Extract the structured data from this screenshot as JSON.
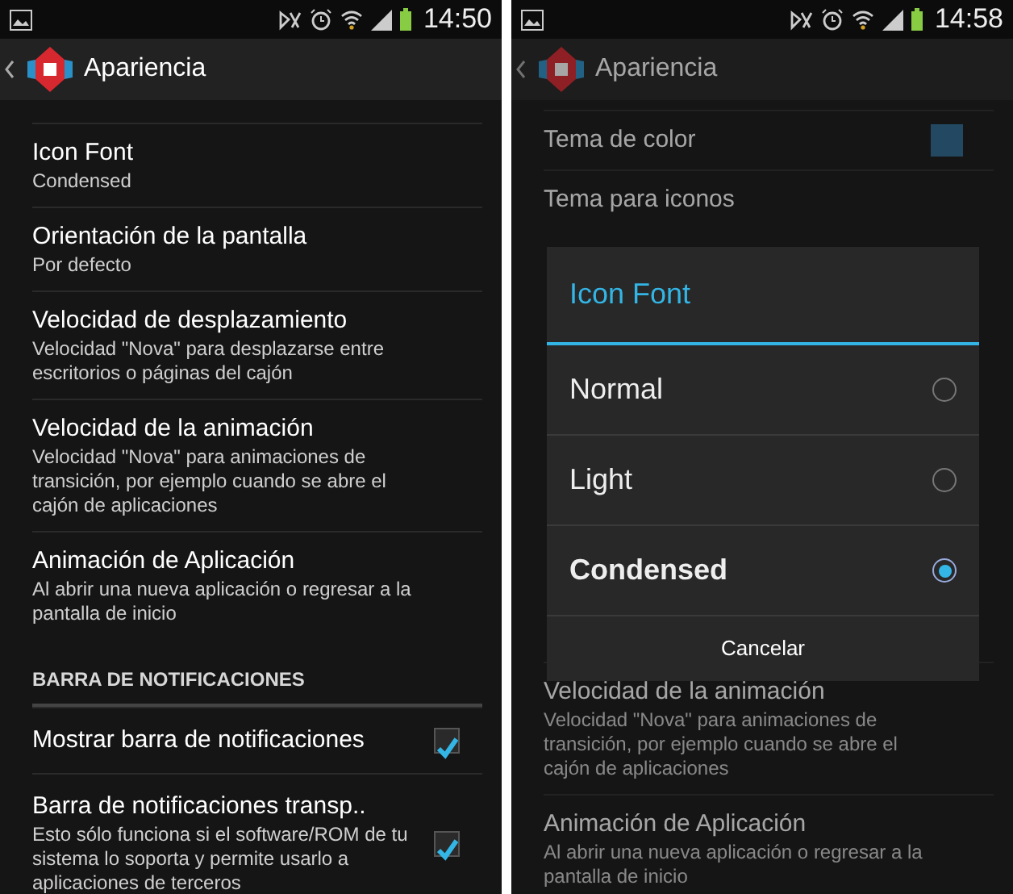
{
  "screens": [
    {
      "status_bar": {
        "time": "14:50"
      },
      "action_bar": {
        "title": "Apariencia"
      },
      "dimmed": false,
      "settings": [
        {
          "kind": "item",
          "title": "Icon Font",
          "summary": "Condensed"
        },
        {
          "kind": "item",
          "title": "Orientación de la pantalla",
          "summary": "Por defecto"
        },
        {
          "kind": "item",
          "title": "Velocidad de desplazamiento",
          "summary": "Velocidad \"Nova\" para desplazarse entre escritorios o páginas del cajón"
        },
        {
          "kind": "item",
          "title": "Velocidad de la animación",
          "summary": "Velocidad \"Nova\" para animaciones de transición, por ejemplo cuando se abre el cajón de aplicaciones"
        },
        {
          "kind": "item",
          "title": "Animación de Aplicación",
          "summary": "Al abrir una nueva aplicación o regresar a la pantalla de inicio"
        },
        {
          "kind": "header",
          "title": "BARRA DE NOTIFICACIONES"
        },
        {
          "kind": "check",
          "title": "Mostrar barra de notificaciones",
          "checked": true
        },
        {
          "kind": "check",
          "title": "Barra de notificaciones transp..",
          "summary": "Esto sólo funciona si el software/ROM de tu sistema lo soporta y permite usarlo a aplicaciones de terceros",
          "checked": true
        }
      ]
    },
    {
      "status_bar": {
        "time": "14:58"
      },
      "action_bar": {
        "title": "Apariencia"
      },
      "dimmed": true,
      "settings": [
        {
          "kind": "swatch",
          "title": "Tema de color"
        },
        {
          "kind": "item",
          "title": "Tema para iconos"
        },
        {
          "kind": "item",
          "title": "Velocidad de la animación",
          "summary": "Velocidad \"Nova\" para animaciones de transición, por ejemplo cuando se abre el cajón de aplicaciones"
        },
        {
          "kind": "item",
          "title": "Animación de Aplicación",
          "summary": "Al abrir una nueva aplicación o regresar a la pantalla de inicio"
        }
      ],
      "dialog": {
        "title": "Icon Font",
        "options": [
          {
            "label": "Normal",
            "selected": false
          },
          {
            "label": "Light",
            "selected": false
          },
          {
            "label": "Condensed",
            "selected": true
          }
        ],
        "cancel": "Cancelar"
      }
    }
  ]
}
